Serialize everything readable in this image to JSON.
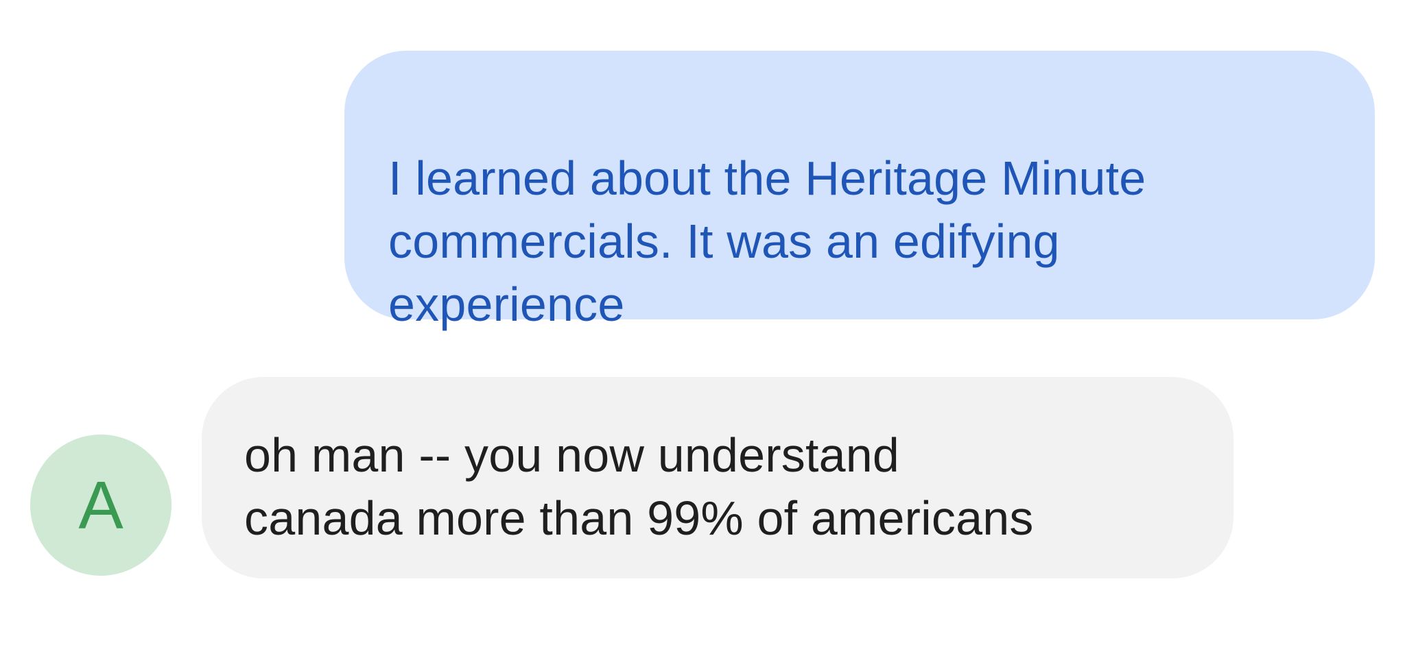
{
  "messages": [
    {
      "direction": "outgoing",
      "text": "I learned about the Heritage Minute\ncommercials. It was an edifying\nexperience"
    },
    {
      "direction": "incoming",
      "sender_initial": "A",
      "text": "oh man -- you now understand\ncanada more than 99% of americans"
    }
  ],
  "colors": {
    "outgoing_bubble": "#d3e3fd",
    "outgoing_text": "#1f55b6",
    "incoming_bubble": "#f2f2f2",
    "incoming_text": "#1f1f1f",
    "avatar_bg": "#cfe9d4",
    "avatar_text": "#3a9a52"
  }
}
